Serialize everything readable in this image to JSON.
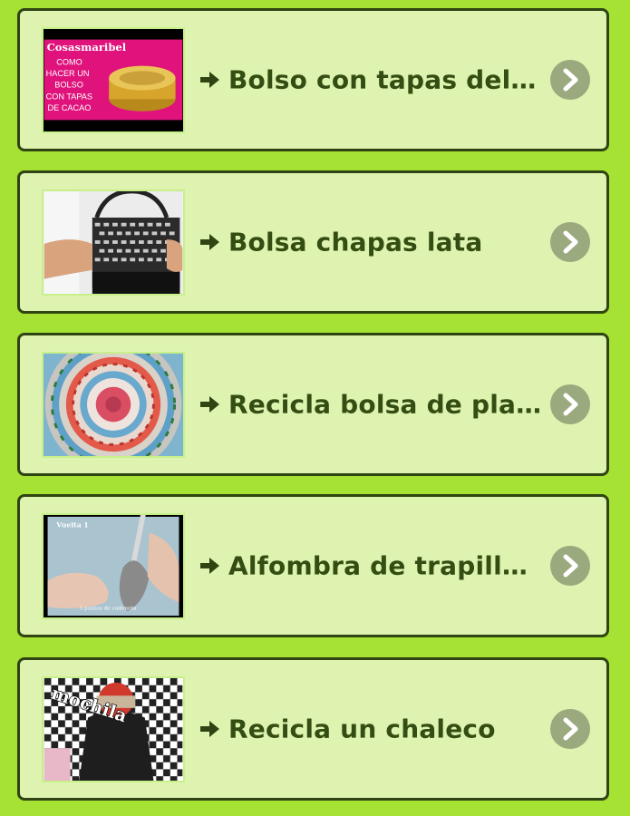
{
  "items": [
    {
      "title": "Bolso con tapas del ca…",
      "thumb_text": {
        "brand": "Cosasmaribel",
        "lines": [
          "COMO",
          "HACER UN",
          "BOLSO",
          "CON TAPAS",
          "DE CACAO"
        ]
      },
      "arrow_icon": "arrow-right-icon",
      "action_icon": "chevron-right-icon"
    },
    {
      "title": "Bolsa chapas lata",
      "arrow_icon": "arrow-right-icon",
      "action_icon": "chevron-right-icon"
    },
    {
      "title": "Recicla bolsa de plastico",
      "arrow_icon": "arrow-right-icon",
      "action_icon": "chevron-right-icon"
    },
    {
      "title": "Alfombra de trapillo a …",
      "thumb_text": {
        "top": "Vuelta 1",
        "bottom": "3 puntos de cadeneta"
      },
      "arrow_icon": "arrow-right-icon",
      "action_icon": "chevron-right-icon"
    },
    {
      "title": "Recicla un chaleco",
      "thumb_text": {
        "overlay": "mochila"
      },
      "arrow_icon": "arrow-right-icon",
      "action_icon": "chevron-right-icon"
    }
  ],
  "colors": {
    "background": "#a6e234",
    "card": "#dff3b0",
    "card_border": "#2f4412",
    "title": "#334d12",
    "chevron_bg": "#9aaa7e"
  }
}
